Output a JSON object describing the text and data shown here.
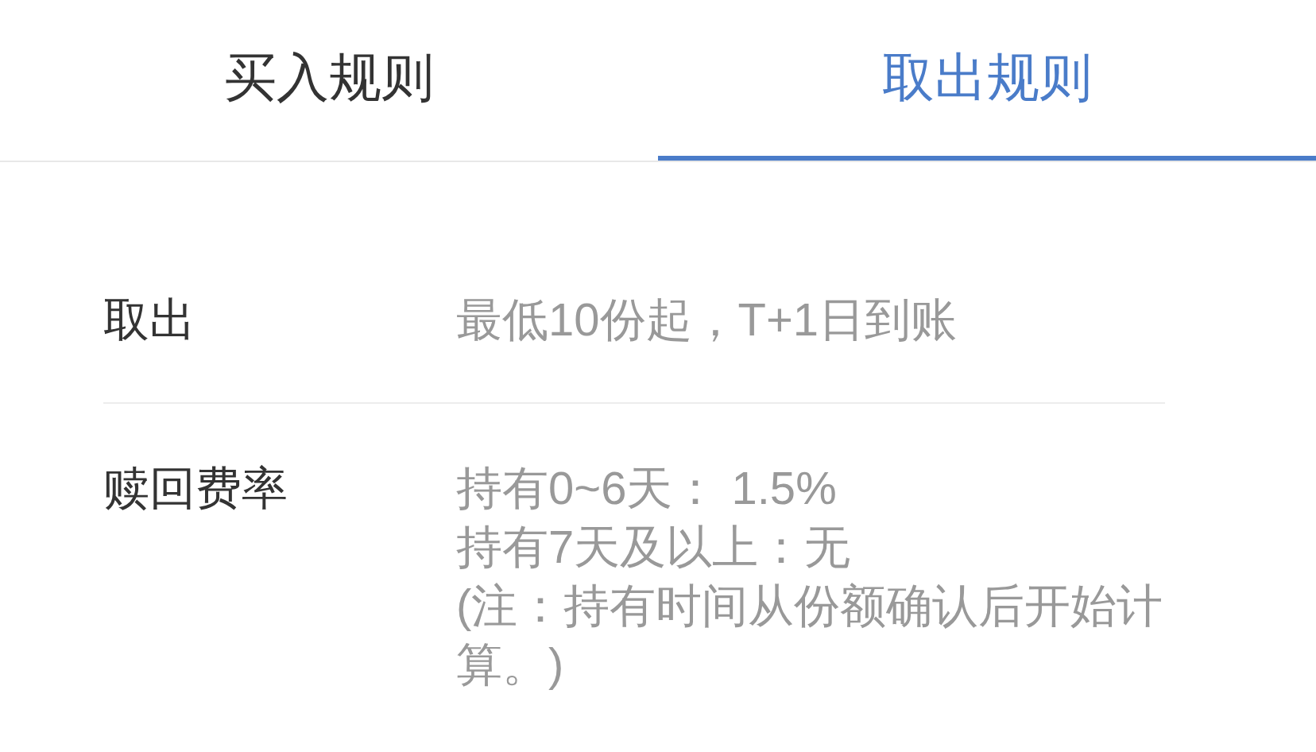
{
  "tabs": [
    {
      "label": "买入规则",
      "selected": false
    },
    {
      "label": "取出规则",
      "selected": true
    }
  ],
  "rows": [
    {
      "label": "取出",
      "lines": [
        "最低10份起，T+1日到账"
      ]
    },
    {
      "label": "赎回费率",
      "lines": [
        "持有0~6天： 1.5%",
        "持有7天及以上：无",
        "(注：持有时间从份额确认后开始计算。)"
      ]
    }
  ]
}
